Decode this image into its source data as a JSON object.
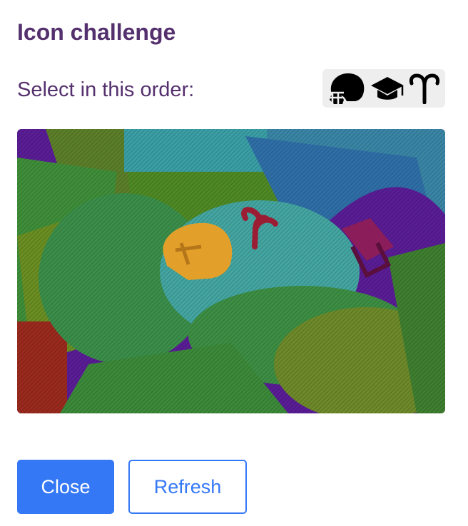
{
  "dialog": {
    "title": "Icon challenge",
    "instruction": "Select in this order:"
  },
  "sequence_icons": [
    "football-helmet-icon",
    "graduation-cap-icon",
    "aries-icon"
  ],
  "challenge_image": {
    "hidden_icons": [
      "football-helmet-icon",
      "aries-icon",
      "graduation-cap-icon"
    ]
  },
  "buttons": {
    "close_label": "Close",
    "refresh_label": "Refresh"
  },
  "colors": {
    "heading": "#55306e",
    "primary": "#3478f6",
    "strip_bg": "#eeeeee"
  }
}
